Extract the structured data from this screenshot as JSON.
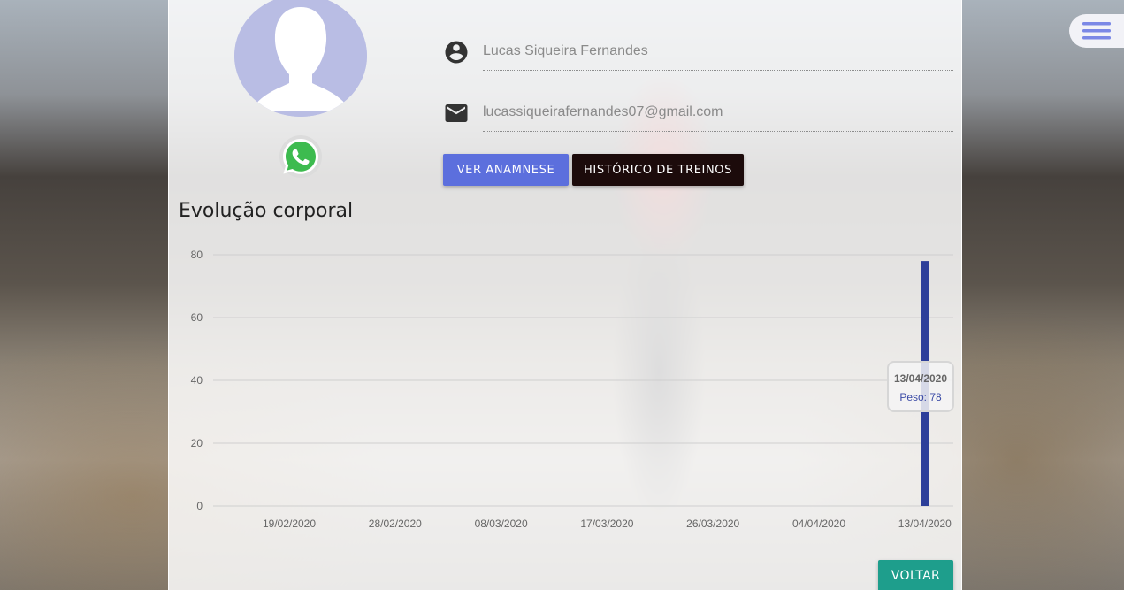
{
  "user": {
    "name": "Lucas Siqueira Fernandes",
    "email": "lucassiqueirafernandes07@gmail.com"
  },
  "icons": {
    "menu": "hamburger-menu-icon",
    "avatar": "user-silhouette",
    "whatsapp": "whatsapp-icon",
    "account": "account-circle-icon",
    "email": "email-icon"
  },
  "actions": {
    "anamnese_label": "VER ANAMNESE",
    "historico_label": "HISTÓRICO DE TREINOS",
    "voltar_label": "VOLTAR"
  },
  "section": {
    "title": "Evolução corporal"
  },
  "colors": {
    "primary": "#5c6fdd",
    "dark_button": "#1c0b0b",
    "teal": "#1e9e8c",
    "bar": "#2d3f9a",
    "menu_icon": "#7b88e6",
    "avatar_bg": "#b9bde4"
  },
  "chart_data": {
    "type": "bar",
    "x_ticks": [
      "19/02/2020",
      "28/02/2020",
      "08/03/2020",
      "17/03/2020",
      "26/03/2020",
      "04/04/2020",
      "13/04/2020"
    ],
    "y_ticks": [
      0,
      20,
      40,
      60,
      80
    ],
    "ylim": [
      0,
      80
    ],
    "series": [
      {
        "name": "Peso",
        "x": [
          "13/04/2020"
        ],
        "values": [
          78
        ]
      }
    ],
    "grid": true,
    "tooltip": {
      "title": "13/04/2020",
      "label": "Peso: 78"
    }
  }
}
